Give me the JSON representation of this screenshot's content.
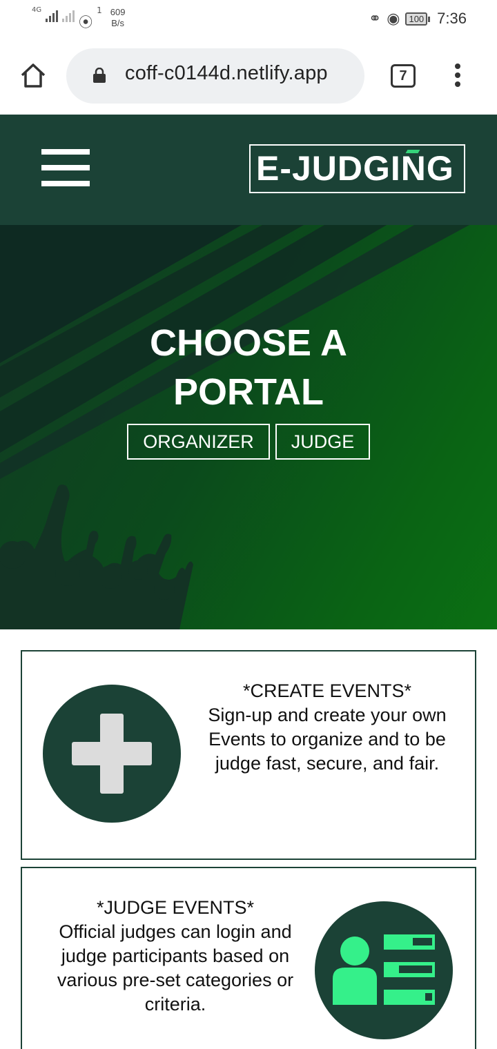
{
  "status_bar": {
    "network_type": "4G",
    "speed_value": "609",
    "speed_unit": "B/s",
    "hotspot_count": "1",
    "battery": "100",
    "time": "7:36"
  },
  "browser": {
    "url": "coff-c0144d.netlify.app",
    "tab_count": "7"
  },
  "site": {
    "logo": "E-JUDGING",
    "hero_title_line1": "CHOOSE A",
    "hero_title_line2": "PORTAL",
    "organizer_button": "ORGANIZER",
    "judge_button": "JUDGE"
  },
  "cards": [
    {
      "heading": "*CREATE EVENTS*",
      "body": "Sign-up and create your own Events to organize and to be judge fast, secure, and fair.",
      "icon": "plus-icon"
    },
    {
      "heading": "*JUDGE EVENTS*",
      "body": "Official judges can login and judge participants based on various pre-set categories or criteria.",
      "icon": "judge-list-icon"
    }
  ],
  "colors": {
    "header_bg": "#1b4236",
    "accent_green": "#35f08a",
    "hero_green": "#0a6414"
  }
}
